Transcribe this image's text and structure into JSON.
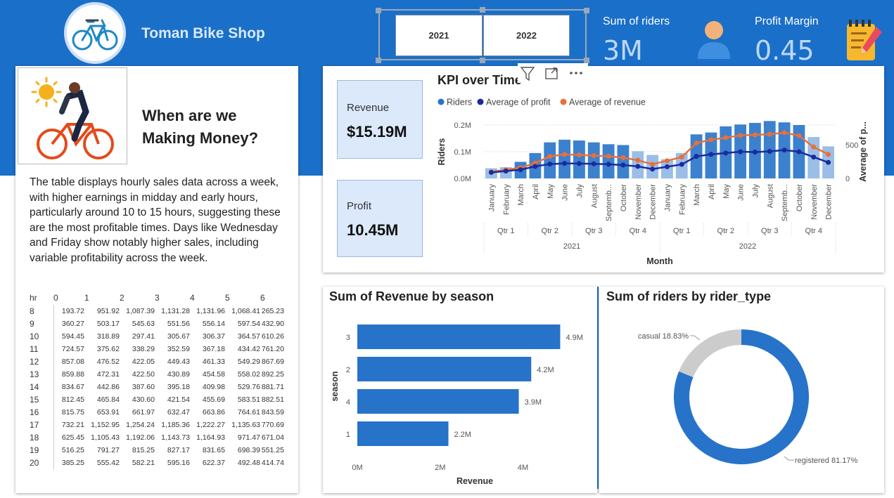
{
  "header": {
    "brand": "Toman Bike Shop",
    "years": [
      "2021",
      "2022"
    ],
    "riders_label": "Sum of riders",
    "riders_value": "3M",
    "margin_label": "Profit Margin",
    "margin_value": "0.45"
  },
  "intro": {
    "title_line1": "When are we",
    "title_line2": "Making Money?",
    "description": "The table displays hourly sales data across a week, with higher earnings in midday and early hours, particularly around 10 to 15 hours, suggesting these are the most profitable times. Days like Wednesday and Friday show notably higher sales, including variable profitability across the week."
  },
  "hourly_table": {
    "corner": "hr",
    "days": [
      "0",
      "1",
      "2",
      "3",
      "4",
      "5",
      "6"
    ],
    "rows": [
      {
        "hr": "8",
        "v": [
          "193.72",
          "951.92",
          "1,087.39",
          "1,131.28",
          "1,131.96",
          "1,068.41",
          "265.23"
        ]
      },
      {
        "hr": "9",
        "v": [
          "360.27",
          "503.17",
          "545.63",
          "551.56",
          "556.14",
          "597.54",
          "432.90"
        ]
      },
      {
        "hr": "10",
        "v": [
          "594.45",
          "318.89",
          "297.41",
          "305.67",
          "306.37",
          "364.57",
          "610.26"
        ]
      },
      {
        "hr": "11",
        "v": [
          "724.57",
          "375.62",
          "338.29",
          "352.59",
          "367.18",
          "434.42",
          "761.20"
        ]
      },
      {
        "hr": "12",
        "v": [
          "857.08",
          "476.52",
          "422.05",
          "449.43",
          "461.33",
          "549.29",
          "867.69"
        ]
      },
      {
        "hr": "13",
        "v": [
          "859.88",
          "472.31",
          "422.50",
          "430.89",
          "454.58",
          "558.02",
          "892.25"
        ]
      },
      {
        "hr": "14",
        "v": [
          "834.67",
          "442.86",
          "387.60",
          "395.18",
          "409.98",
          "529.76",
          "881.71"
        ]
      },
      {
        "hr": "15",
        "v": [
          "812.45",
          "465.84",
          "430.60",
          "421.54",
          "455.69",
          "583.51",
          "882.51"
        ]
      },
      {
        "hr": "16",
        "v": [
          "815.75",
          "653.91",
          "661.97",
          "632.47",
          "663.86",
          "764.61",
          "843.59"
        ]
      },
      {
        "hr": "17",
        "v": [
          "732.21",
          "1,152.95",
          "1,254.24",
          "1,185.36",
          "1,222.27",
          "1,135.63",
          "770.69"
        ]
      },
      {
        "hr": "18",
        "v": [
          "625.45",
          "1,105.43",
          "1,192.06",
          "1,143.73",
          "1,164.93",
          "971.47",
          "671.04"
        ]
      },
      {
        "hr": "19",
        "v": [
          "516.25",
          "791.27",
          "815.25",
          "827.17",
          "831.65",
          "698.39",
          "551.25"
        ]
      },
      {
        "hr": "20",
        "v": [
          "385.25",
          "555.42",
          "582.21",
          "595.16",
          "622.37",
          "492.48",
          "414.74"
        ]
      }
    ]
  },
  "cards": {
    "revenue_label": "Revenue",
    "revenue_value": "$15.19M",
    "profit_label": "Profit",
    "profit_value": "10.45M"
  },
  "colors": {
    "band": "#1a6fc9",
    "bar": "#2673c9",
    "bar_light": "#8fb7e6",
    "profit_line": "#1c2a9e",
    "revenue_line": "#e8703a",
    "donut_casual": "#cccccc"
  },
  "icons": [
    "bicycle-logo-icon",
    "user-icon",
    "notepad-icon",
    "sun-icon",
    "cyclist-illustration",
    "filter-icon",
    "focus-mode-icon",
    "more-options-icon"
  ],
  "chart_data": [
    {
      "type": "bar+line",
      "title": "KPI over Time",
      "legend": [
        "Riders",
        "Average of profit",
        "Average of revenue"
      ],
      "legend_position": "top-left",
      "xlabel": "Month",
      "ylabel": "Riders",
      "y2label": "Average of p...",
      "ylim": [
        0,
        200000
      ],
      "yticks": [
        "0.0M",
        "0.1M",
        "0.2M"
      ],
      "y2ticks": [
        "0",
        "500"
      ],
      "y2lim": [
        0,
        800
      ],
      "months": [
        "January",
        "February",
        "March",
        "April",
        "May",
        "June",
        "July",
        "August",
        "Septemb...",
        "October",
        "November",
        "December",
        "January",
        "February",
        "March",
        "April",
        "May",
        "June",
        "July",
        "August",
        "Septemb...",
        "October",
        "November",
        "December"
      ],
      "quarters": [
        {
          "label": "Qtr 1",
          "span": 3
        },
        {
          "label": "Qtr 2",
          "span": 3
        },
        {
          "label": "Qtr 3",
          "span": 3
        },
        {
          "label": "Qtr 4",
          "span": 3
        },
        {
          "label": "Qtr 1",
          "span": 3
        },
        {
          "label": "Qtr 2",
          "span": 3
        },
        {
          "label": "Qtr 3",
          "span": 3
        },
        {
          "label": "Qtr 4",
          "span": 3
        }
      ],
      "years": [
        {
          "label": "2021",
          "span": 12
        },
        {
          "label": "2022",
          "span": 12
        }
      ],
      "series": [
        {
          "name": "Riders",
          "values": [
            38000,
            42000,
            62000,
            95000,
            135000,
            145000,
            142000,
            135000,
            128000,
            125000,
            102000,
            88000,
            72000,
            95000,
            165000,
            172000,
            195000,
            202000,
            208000,
            215000,
            210000,
            200000,
            155000,
            120000
          ]
        },
        {
          "name": "Average of profit",
          "values": [
            90,
            110,
            130,
            180,
            215,
            225,
            222,
            218,
            212,
            200,
            180,
            140,
            175,
            210,
            330,
            360,
            380,
            400,
            395,
            405,
            425,
            400,
            320,
            240
          ]
        },
        {
          "name": "Average of revenue",
          "values": [
            100,
            130,
            160,
            230,
            330,
            360,
            352,
            342,
            332,
            312,
            272,
            212,
            265,
            320,
            530,
            580,
            610,
            645,
            652,
            662,
            685,
            640,
            470,
            360
          ]
        }
      ]
    },
    {
      "type": "bar",
      "orientation": "horizontal",
      "title": "Sum of Revenue by season",
      "categories": [
        "3",
        "2",
        "4",
        "1"
      ],
      "values": [
        4.9,
        4.2,
        3.9,
        2.2
      ],
      "value_labels": [
        "4.9M",
        "4.2M",
        "3.9M",
        "2.2M"
      ],
      "xticks": [
        "0M",
        "2M",
        "4M"
      ],
      "xlim": [
        0,
        5.3
      ],
      "xlabel": "Revenue",
      "ylabel": "season"
    },
    {
      "type": "pie",
      "style": "donut",
      "title": "Sum of riders by rider_type",
      "slices": [
        {
          "label": "registered 81.17%",
          "value": 81.17
        },
        {
          "label": "casual 18.83%",
          "value": 18.83
        }
      ]
    }
  ]
}
